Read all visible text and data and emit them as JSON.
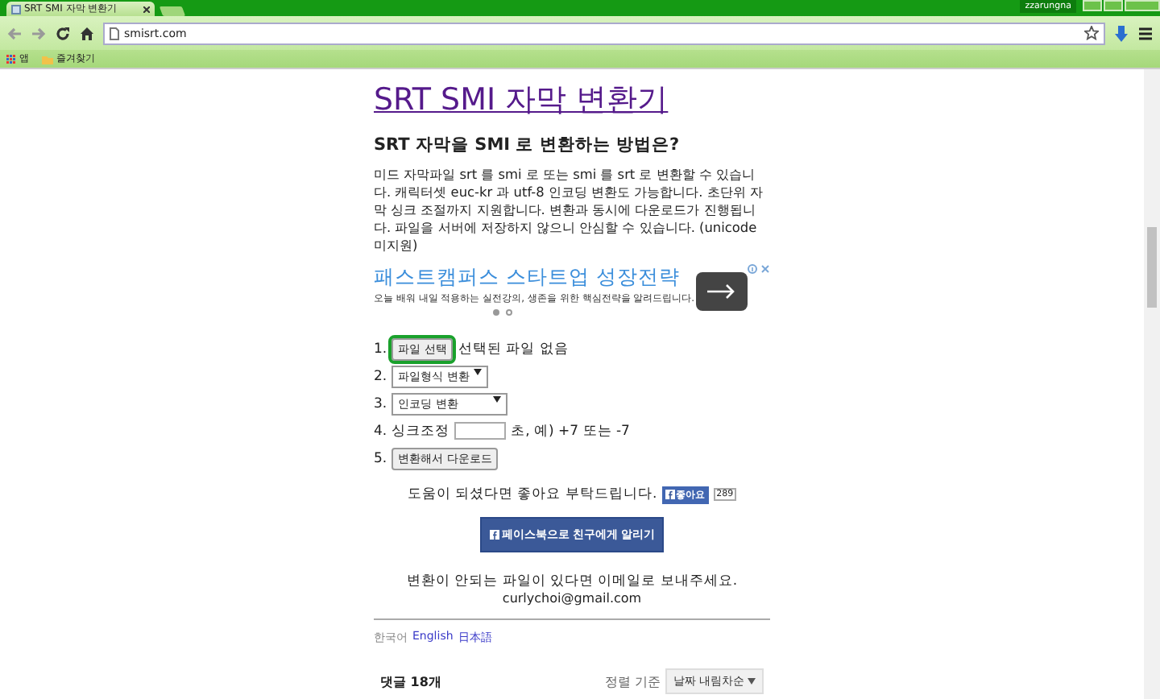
{
  "browser": {
    "tab_title": "SRT SMI 자막 변환기",
    "user": "zzarungna",
    "url": "smisrt.com",
    "bookmarks": [
      {
        "label": "앱",
        "kind": "apps"
      },
      {
        "label": "즐겨찾기",
        "kind": "folder"
      }
    ]
  },
  "page": {
    "title": "SRT SMI 자막 변환기",
    "subtitle": "SRT 자막을 SMI 로 변환하는 방법은?",
    "description": "미드 자막파일 srt 를 smi 로 또는 smi 를 srt 로 변환할 수 있습니다. 캐릭터셋 euc-kr 과 utf-8 인코딩 변환도 가능합니다. 초단위 자막 싱크 조절까지 지원합니다. 변환과 동시에 다운로드가 진행됩니다. 파일을 서버에 저장하지 않으니 안심할 수 있습니다. (unicode 미지원)",
    "ad": {
      "headline": "패스트캠퍼스 스타트업 성장전략",
      "text": "오늘 배워 내일 적용하는 실전강의, 생존을 위한 핵심전략을 알려드립니다.",
      "dots": [
        {
          "selected": true
        },
        {
          "selected": false
        }
      ]
    },
    "steps": [
      {
        "number": "1.",
        "kind": "file",
        "button": "파일 선택",
        "note": "선택된 파일 없음"
      },
      {
        "number": "2.",
        "kind": "select",
        "value": "파일형식 변환"
      },
      {
        "number": "3.",
        "kind": "select",
        "value": "인코딩 변환"
      },
      {
        "number": "4.",
        "kind": "input",
        "label": "싱크조정",
        "note": "초, 예) +7 또는 -7"
      },
      {
        "number": "5.",
        "kind": "button",
        "button": "변환해서 다운로드"
      }
    ],
    "like_text": "도움이 되셨다면 좋아요 부탁드립니다.",
    "like_button": "좋아요",
    "like_count": "289",
    "share_button": "페이스북으로 친구에게 알리기",
    "contact_text": "변환이 안되는 파일이 있다면 이메일로 보내주세요.",
    "email": "curlychoi@gmail.com",
    "languages": [
      {
        "label": "한국어",
        "selected": true
      },
      {
        "label": "English",
        "selected": false
      },
      {
        "label": "日本語",
        "selected": false
      }
    ],
    "comments": {
      "count": "댓글 18개",
      "sort_label": "정렬 기준",
      "sort_value": "날짜 내림차순"
    }
  }
}
